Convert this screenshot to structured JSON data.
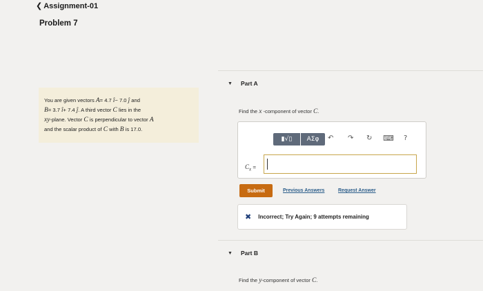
{
  "breadcrumb": {
    "icon": "chevron-left-icon",
    "label": "Assignment-01"
  },
  "problem": {
    "title": "Problem 7",
    "statement": {
      "l1_a": "You are given vectors ",
      "vec_A": "A",
      "l1_b": "= 4.7 ",
      "i_hat": "î",
      "l1_c": "− 7.0 ",
      "j_hat": "ĵ",
      "l1_d": " and",
      "vec_B": "B",
      "l2_a": "= 3.7 ",
      "l2_b": "+ 7.4 ",
      "l2_c": ". A third vector ",
      "vec_C": "C",
      "l2_d": " lies in the",
      "plane_var": "xy",
      "l3_a": "-plane. Vector ",
      "l3_b": " is perpendicular to vector ",
      "l4_a": "and the scalar product of ",
      "l4_b": " with ",
      "l4_c": " is 17.0."
    }
  },
  "part_a": {
    "label": "Part A",
    "prompt_a": "Find the ",
    "prompt_var": "x",
    "prompt_b": " -component of vector ",
    "prompt_vec": "C",
    "prompt_end": ".",
    "toolbar": {
      "templates_label": "▮√▯",
      "symbols_label": "ΑΣφ",
      "undo_icon": "undo-icon",
      "redo_icon": "redo-icon",
      "reset_icon": "reset-icon",
      "keyboard_icon": "keyboard-icon",
      "help_label": "?"
    },
    "input_label_var": "C",
    "input_label_sub": "x",
    "input_label_eq": " =",
    "input_value": "",
    "submit_label": "Submit",
    "previous_answers_label": "Previous Answers",
    "request_answer_label": "Request Answer",
    "feedback": {
      "icon": "incorrect-x-icon",
      "message": "Incorrect; Try Again; 9 attempts remaining",
      "icon_color": "#1f3f7a"
    }
  },
  "part_b": {
    "label": "Part B",
    "prompt_a": "Find the ",
    "prompt_var": "y",
    "prompt_b": "-component of vector ",
    "prompt_vec": "C",
    "prompt_end": "."
  },
  "colors": {
    "background": "#f2f1ef",
    "problem_box": "#f4eedb",
    "toolbar_button": "#5f6a7a",
    "submit_button": "#c76b12",
    "link": "#2b5d8a",
    "input_border": "#c7a54a"
  }
}
